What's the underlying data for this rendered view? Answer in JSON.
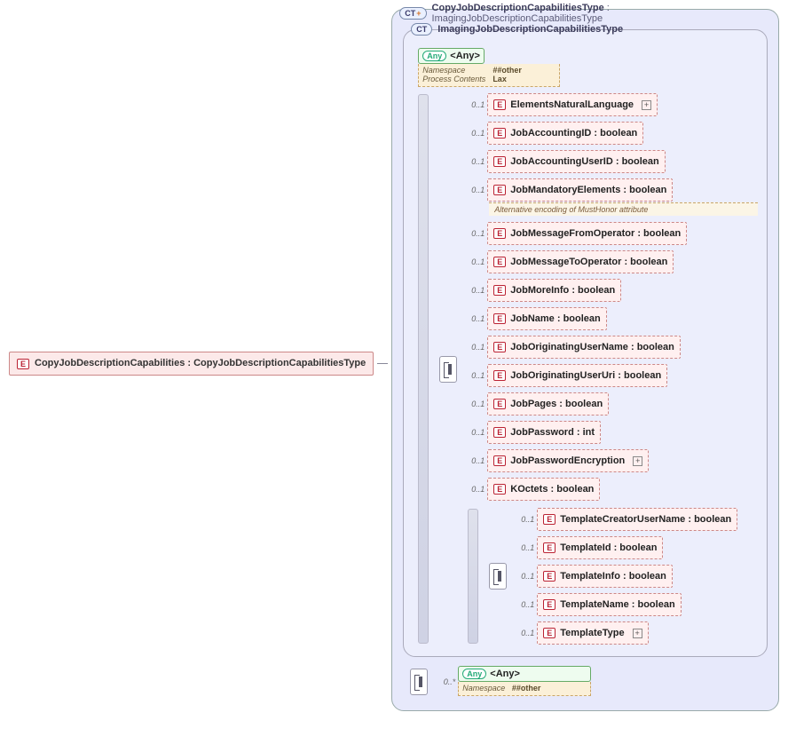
{
  "root": {
    "label": "CopyJobDescriptionCapabilities : CopyJobDescriptionCapabilitiesType"
  },
  "outer_ct": {
    "badge": "CT",
    "title": "CopyJobDescriptionCapabilitiesType",
    "base": ": ImagingJobDescriptionCapabilitiesType"
  },
  "inner_ct": {
    "badge": "CT",
    "title": "ImagingJobDescriptionCapabilitiesType"
  },
  "any1": {
    "label": "<Any>",
    "meta_keys": "Namespace\nProcess Contents",
    "meta_values": "##other\nLax"
  },
  "occ_opt": "0..1",
  "occ_many": "0..*",
  "elements": {
    "e1": "ElementsNaturalLanguage",
    "e2": "JobAccountingID : boolean",
    "e3": "JobAccountingUserID : boolean",
    "e4": "JobMandatoryElements : boolean",
    "e4_note": "Alternative encoding of MustHonor attribute",
    "e5": "JobMessageFromOperator : boolean",
    "e6": "JobMessageToOperator : boolean",
    "e7": "JobMoreInfo : boolean",
    "e8": "JobName : boolean",
    "e9": "JobOriginatingUserName : boolean",
    "e10": "JobOriginatingUserUri : boolean",
    "e11": "JobPages : boolean",
    "e12": "JobPassword : int",
    "e13": "JobPasswordEncryption",
    "e14": "KOctets  : boolean"
  },
  "template_elements": {
    "t1": "TemplateCreatorUserName : boolean",
    "t2": "TemplateId : boolean",
    "t3": "TemplateInfo : boolean",
    "t4": "TemplateName : boolean",
    "t5": "TemplateType"
  },
  "any2": {
    "label": "<Any>",
    "meta_keys": "Namespace",
    "meta_values": "##other"
  }
}
